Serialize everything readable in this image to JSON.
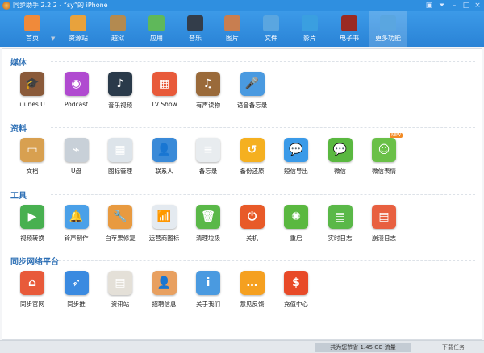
{
  "window": {
    "title": "同步助手 2.2.2 - “sy”的 iPhone",
    "controls": [
      "feedback",
      "menu",
      "minimize",
      "maximize",
      "close"
    ]
  },
  "nav": {
    "items": [
      {
        "label": "首页",
        "color": "#f08a3a"
      },
      {
        "label": "资源站",
        "color": "#e8a23c"
      },
      {
        "label": "越狱",
        "color": "#b38a50"
      },
      {
        "label": "应用",
        "color": "#5fb85a"
      },
      {
        "label": "音乐",
        "color": "#333d4a"
      },
      {
        "label": "图片",
        "color": "#c87e50"
      },
      {
        "label": "文件",
        "color": "#5aa6e0"
      },
      {
        "label": "影片",
        "color": "#3a9fe0"
      },
      {
        "label": "电子书",
        "color": "#9a2a22"
      },
      {
        "label": "更多功能",
        "color": "#5aa6e0",
        "active": true
      }
    ]
  },
  "sections": [
    {
      "title": "媒体",
      "items": [
        {
          "label": "iTunes U",
          "color": "#8a5a3a",
          "glyph": "🎓"
        },
        {
          "label": "Podcast",
          "color": "#b04ad0",
          "glyph": "◉"
        },
        {
          "label": "音乐视频",
          "color": "#2a3a4a",
          "glyph": "♪"
        },
        {
          "label": "TV Show",
          "color": "#e85a3a",
          "glyph": "▦"
        },
        {
          "label": "有声读物",
          "color": "#9a6a3a",
          "glyph": "♫"
        },
        {
          "label": "语音备忘录",
          "color": "#4a9ae0",
          "glyph": "🎤"
        }
      ]
    },
    {
      "title": "资料",
      "items": [
        {
          "label": "文档",
          "color": "#d8a050",
          "glyph": "▭"
        },
        {
          "label": "U盘",
          "color": "#c8d0d8",
          "glyph": "⌁"
        },
        {
          "label": "图标管理",
          "color": "#dde4ea",
          "glyph": "▦"
        },
        {
          "label": "联系人",
          "color": "#3a8ad8",
          "glyph": "👤"
        },
        {
          "label": "备忘录",
          "color": "#e8ecef",
          "glyph": "≡"
        },
        {
          "label": "备份还原",
          "color": "#f5b020",
          "glyph": "↺"
        },
        {
          "label": "短信导出",
          "color": "#3a9ae8",
          "glyph": "💬"
        },
        {
          "label": "微信",
          "color": "#5ab840",
          "glyph": "💬"
        },
        {
          "label": "微信表情",
          "color": "#6ac048",
          "glyph": "☺",
          "badge": "NEW"
        }
      ]
    },
    {
      "title": "工具",
      "items": [
        {
          "label": "视频转换",
          "color": "#48b050",
          "glyph": "▶"
        },
        {
          "label": "铃声制作",
          "color": "#4aa0e8",
          "glyph": "🔔"
        },
        {
          "label": "白苹果修复",
          "color": "#e89a40",
          "glyph": "🔧"
        },
        {
          "label": "运营商图标",
          "color": "#e4eaf0",
          "glyph": "📶"
        },
        {
          "label": "清理垃圾",
          "color": "#5ab848",
          "glyph": "🗑"
        },
        {
          "label": "关机",
          "color": "#e85a28",
          "glyph": "⏻"
        },
        {
          "label": "重启",
          "color": "#5ab840",
          "glyph": "✺"
        },
        {
          "label": "实时日志",
          "color": "#5ab848",
          "glyph": "▤"
        },
        {
          "label": "崩溃日志",
          "color": "#e86040",
          "glyph": "▤"
        }
      ]
    },
    {
      "title": "同步网络平台",
      "items": [
        {
          "label": "同步官网",
          "color": "#e85a3a",
          "glyph": "⌂"
        },
        {
          "label": "同步推",
          "color": "#3a8ae0",
          "glyph": "➶"
        },
        {
          "label": "资讯站",
          "color": "#e4e0d8",
          "glyph": "▤"
        },
        {
          "label": "招聘信息",
          "color": "#e8a060",
          "glyph": "👤"
        },
        {
          "label": "关于我们",
          "color": "#4a9ae0",
          "glyph": "i"
        },
        {
          "label": "意见反馈",
          "color": "#f5a020",
          "glyph": "…"
        },
        {
          "label": "充值中心",
          "color": "#e84a28",
          "glyph": "$"
        }
      ]
    }
  ],
  "status": {
    "saved": "共为您节省 1.45 GB 流量",
    "downloads": "下载任务"
  }
}
